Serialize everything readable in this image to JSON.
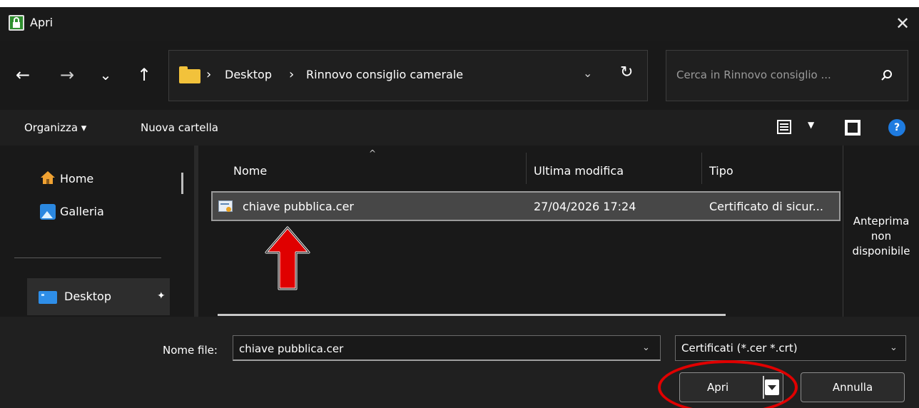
{
  "window": {
    "title": "Apri",
    "close_glyph": "✕",
    "icon": "lock-icon"
  },
  "nav": {
    "back": "←",
    "forward": "→",
    "recent": "⌄",
    "up": "↑"
  },
  "address": {
    "icon": "folder-icon",
    "separator": "›",
    "crumbs": [
      "Desktop",
      "Rinnovo consiglio camerale"
    ],
    "dropdown_glyph": "⌄",
    "refresh_glyph": "↻"
  },
  "search": {
    "placeholder": "Cerca in Rinnovo consiglio ...",
    "icon": "search-icon"
  },
  "commands": {
    "organize": "Organizza ▾",
    "new_folder": "Nuova cartella"
  },
  "sidebar": {
    "items": [
      {
        "label": "Home",
        "icon": "home-icon"
      },
      {
        "label": "Galleria",
        "icon": "gallery-icon"
      },
      {
        "label": "Desktop",
        "icon": "desktop-icon",
        "pinned": true
      }
    ],
    "pin_glyph": "📌"
  },
  "file_list": {
    "columns": [
      "Nome",
      "Ultima modifica",
      "Tipo"
    ],
    "sort_glyph": "^",
    "rows": [
      {
        "name": "chiave pubblica.cer",
        "modified": "27/04/2026 17:24",
        "type": "Certificato di sicur...",
        "selected": true
      }
    ]
  },
  "preview": {
    "lines": [
      "Anteprima",
      "non",
      "disponibile"
    ]
  },
  "footer": {
    "filename_label": "Nome file:",
    "filename_value": "chiave pubblica.cer",
    "filter_value": "Certificati (*.cer *.crt)",
    "open_label": "Apri",
    "cancel_label": "Annulla",
    "dropdown_glyph": "⌄"
  },
  "colors": {
    "accent": "#1e7be0",
    "annotation": "#e00000",
    "folder": "#f2c23b"
  }
}
